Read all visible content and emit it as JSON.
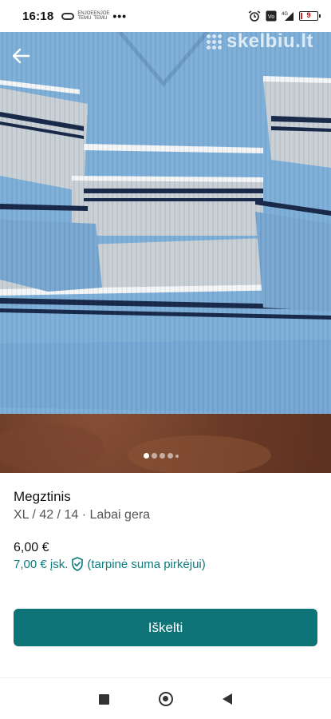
{
  "status_bar": {
    "time": "16:18",
    "mini_label_1": "ENJOE TEMU",
    "mini_label_2": "ENJOE TEMU",
    "more": "•••",
    "network": "4G",
    "battery_level": "9",
    "battery_fill_percent": 9
  },
  "photo": {
    "watermark": "skelbiu.lt",
    "pager_count": 5,
    "pager_active_index": 0
  },
  "listing": {
    "title": "Megztinis",
    "subtitle": "XL / 42 / 14 · Labai gera",
    "price": "6,00 €",
    "price_incl_amount": "7,00 € įsk.",
    "price_incl_note": "(tarpinė suma pirkėjui)"
  },
  "actions": {
    "promote_label": "Iškelti"
  },
  "colors": {
    "accent": "#0d7377",
    "incl_text": "#0a7b7e",
    "sweater_blue": "#7fb0d9",
    "sweater_grey": "#c9d0d6",
    "stripe_navy": "#1a2a4a"
  }
}
